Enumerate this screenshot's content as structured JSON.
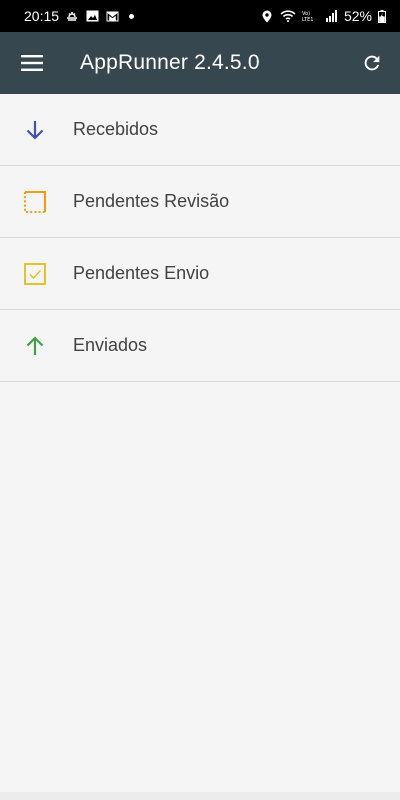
{
  "status_bar": {
    "time": "20:15",
    "left_icons": [
      "weather-icon",
      "image-icon",
      "gmail-icon",
      "dot-icon"
    ],
    "right_icons": [
      "location-icon",
      "wifi-icon",
      "volte-icon",
      "signal-icon"
    ],
    "volte_text": "Vo)\nLTE1",
    "battery_percent": "52%",
    "battery_charging": true
  },
  "app_bar": {
    "title": "AppRunner 2.4.5.0",
    "menu_icon": "hamburger-menu-icon",
    "refresh_icon": "refresh-icon",
    "background": "#37474f"
  },
  "list": {
    "items": [
      {
        "label": "Recebidos",
        "icon": "arrow-down-icon",
        "color": "#3f51b5"
      },
      {
        "label": "Pendentes Revisão",
        "icon": "dotted-square-icon",
        "color": "#f39c12"
      },
      {
        "label": "Pendentes Envio",
        "icon": "checkbox-icon",
        "color": "#e6c229"
      },
      {
        "label": "Enviados",
        "icon": "arrow-up-icon",
        "color": "#43a047"
      }
    ]
  }
}
